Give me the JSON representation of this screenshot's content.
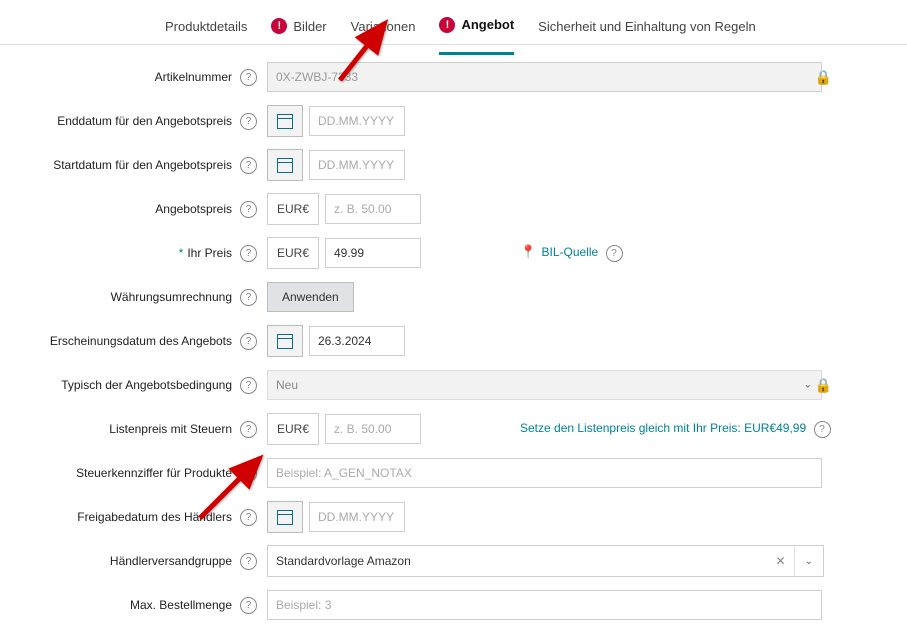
{
  "tabs": {
    "t0": "Produktdetails",
    "t1": "Bilder",
    "t2": "Variationen",
    "t3": "Angebot",
    "t4": "Sicherheit und Einhaltung von Regeln"
  },
  "labels": {
    "articleNumber": "Artikelnummer",
    "endDate": "Enddatum für den Angebotspreis",
    "startDate": "Startdatum für den Angebotspreis",
    "offerPrice": "Angebotspreis",
    "yourPrice": "Ihr Preis",
    "currencyConversion": "Währungsumrechnung",
    "releaseDateOffer": "Erscheinungsdatum des Angebots",
    "conditionType": "Typisch der Angebotsbedingung",
    "listPriceTax": "Listenpreis mit Steuern",
    "taxCode": "Steuerkennziffer für Produkte",
    "sellerReleaseDate": "Freigabedatum des Händlers",
    "sellerShippingGroup": "Händlerversandgruppe",
    "maxOrderQty": "Max. Bestellmenge"
  },
  "values": {
    "articleNumber": "0X-ZWBJ-7333",
    "currencyLabel": "EUR€",
    "yourPrice": "49.99",
    "releaseDateOffer": "26.3.2024",
    "conditionType": "Neu",
    "sellerShippingGroup": "Standardvorlage Amazon"
  },
  "placeholders": {
    "date": "DD.MM.YYYY",
    "price": "z. B. 50.00",
    "taxCode": "Beispiel: A_GEN_NOTAX",
    "maxQty": "Beispiel: 3"
  },
  "extras": {
    "bilSource": "BIL-Quelle",
    "applyBtn": "Anwenden",
    "setListPriceLink": "Setze den Listenpreis gleich mit Ihr Preis: EUR€49,99"
  }
}
